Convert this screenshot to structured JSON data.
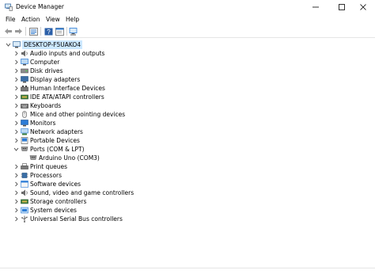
{
  "window": {
    "title": "Device Manager",
    "icon": "device-manager-icon"
  },
  "menu": [
    "File",
    "Action",
    "View",
    "Help"
  ],
  "toolbar": [
    "back-arrow-icon",
    "forward-arrow-icon",
    "properties-icon",
    "help-icon",
    "properties-sheet-icon",
    "scan-hardware-icon"
  ],
  "tree": {
    "root": "DESKTOP-F5UAKO4",
    "categories": [
      {
        "label": "Audio inputs and outputs",
        "icon": "speaker-icon",
        "expanded": false
      },
      {
        "label": "Computer",
        "icon": "computer-icon",
        "expanded": false
      },
      {
        "label": "Disk drives",
        "icon": "disk-drive-icon",
        "expanded": false
      },
      {
        "label": "Display adapters",
        "icon": "display-adapter-icon",
        "expanded": false
      },
      {
        "label": "Human Interface Devices",
        "icon": "hid-icon",
        "expanded": false
      },
      {
        "label": "IDE ATA/ATAPI controllers",
        "icon": "ide-controller-icon",
        "expanded": false
      },
      {
        "label": "Keyboards",
        "icon": "keyboard-icon",
        "expanded": false
      },
      {
        "label": "Mice and other pointing devices",
        "icon": "mouse-icon",
        "expanded": false
      },
      {
        "label": "Monitors",
        "icon": "monitor-icon",
        "expanded": false
      },
      {
        "label": "Network adapters",
        "icon": "network-adapter-icon",
        "expanded": false
      },
      {
        "label": "Portable Devices",
        "icon": "portable-device-icon",
        "expanded": false
      },
      {
        "label": "Ports (COM & LPT)",
        "icon": "port-icon",
        "expanded": true,
        "children": [
          {
            "label": "Arduino Uno (COM3)",
            "icon": "port-icon"
          }
        ]
      },
      {
        "label": "Print queues",
        "icon": "printer-icon",
        "expanded": false
      },
      {
        "label": "Processors",
        "icon": "processor-icon",
        "expanded": false
      },
      {
        "label": "Software devices",
        "icon": "software-device-icon",
        "expanded": false
      },
      {
        "label": "Sound, video and game controllers",
        "icon": "sound-controller-icon",
        "expanded": false
      },
      {
        "label": "Storage controllers",
        "icon": "storage-controller-icon",
        "expanded": false
      },
      {
        "label": "System devices",
        "icon": "system-device-icon",
        "expanded": false
      },
      {
        "label": "Universal Serial Bus controllers",
        "icon": "usb-icon",
        "expanded": false
      }
    ]
  },
  "colors": {
    "selection": "#cce8ff",
    "icon_blue": "#2b7bd6"
  }
}
